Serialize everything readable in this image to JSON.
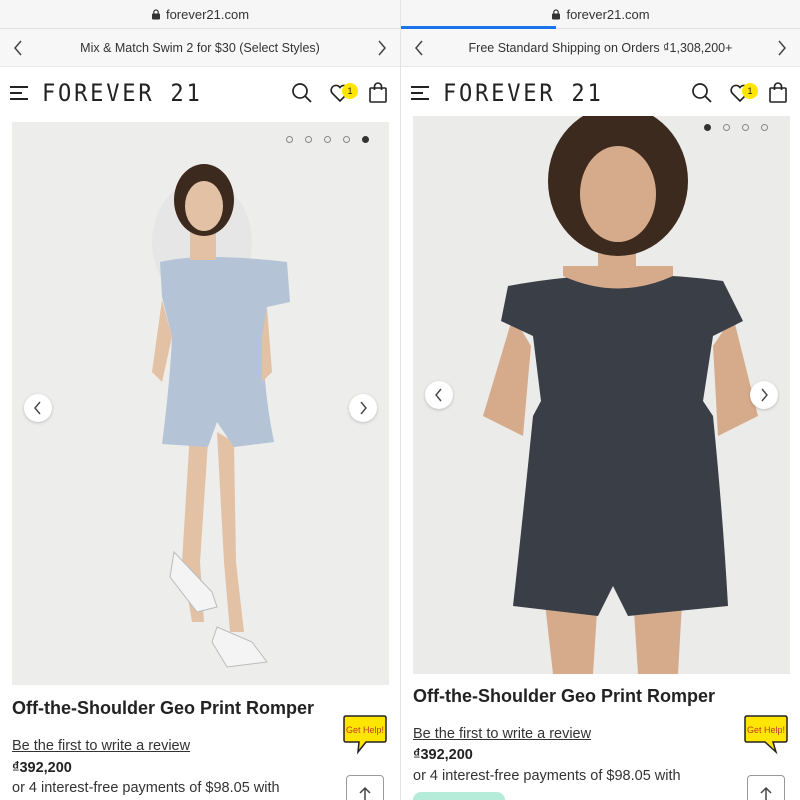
{
  "left": {
    "url": "forever21.com",
    "promo": "Mix & Match Swim 2 for $30 (Select Styles)",
    "logo": "FOREVER 21",
    "wishlist_count": "1",
    "product_title": "Off-the-Shoulder Geo Print Romper",
    "review_link": "Be the first to write a review",
    "price": "₫392,200",
    "payments": "or 4 interest-free payments of $98.05 with",
    "gethelp": "Get Help!",
    "slides": 5,
    "active_slide": 5,
    "garment_color": "#b4c4d6"
  },
  "right": {
    "url": "forever21.com",
    "promo": "Free Standard Shipping on Orders ₫1,308,200+",
    "logo": "FOREVER 21",
    "wishlist_count": "1",
    "product_title": "Off-the-Shoulder Geo Print Romper",
    "review_link": "Be the first to write a review",
    "price": "₫392,200",
    "payments": "or 4 interest-free payments of $98.05 with",
    "gethelp": "Get Help!",
    "slides": 4,
    "active_slide": 1,
    "garment_color": "#3a3e46"
  },
  "colors": {
    "badge": "#ffe600",
    "loading_bar": "#1a73e8",
    "gallery_bg": "#ebebeb",
    "gethelp_bubble": "#ffe600",
    "mint_button": "#b4ecd9"
  },
  "icons": [
    "lock-icon",
    "chevron-left-icon",
    "chevron-right-icon",
    "hamburger-menu-icon",
    "search-icon",
    "heart-icon",
    "shopping-bag-icon",
    "arrow-up-icon",
    "chat-bubble-icon"
  ]
}
